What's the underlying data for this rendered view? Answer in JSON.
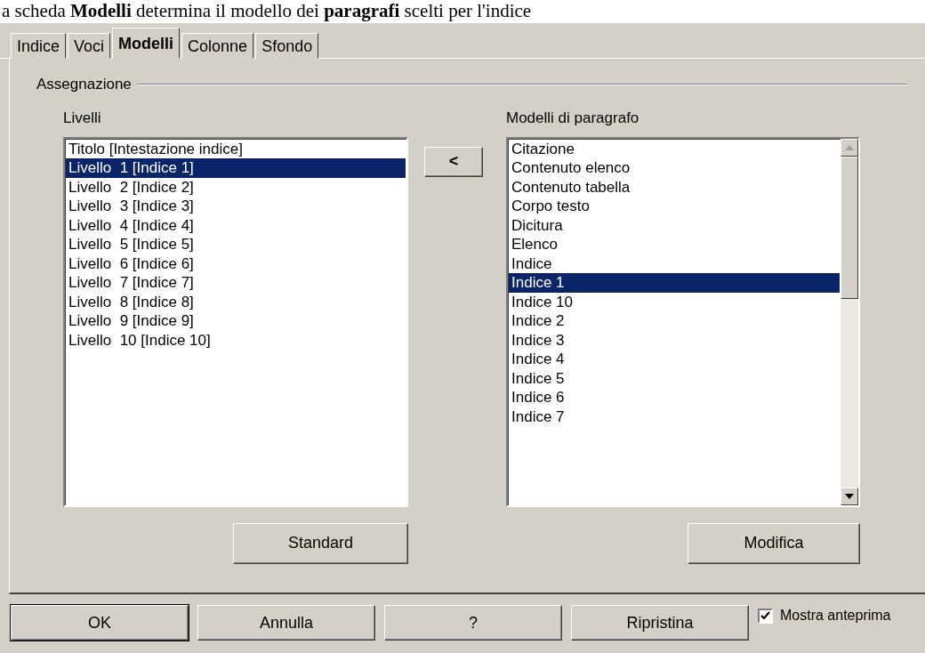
{
  "caption": "a scheda **Modelli** determina il modello dei **paragrafi** scelti per l'indice",
  "tabs": [
    {
      "label": "Indice",
      "selected": false
    },
    {
      "label": "Voci",
      "selected": false
    },
    {
      "label": "Modelli",
      "selected": true
    },
    {
      "label": "Colonne",
      "selected": false
    },
    {
      "label": "Sfondo",
      "selected": false
    }
  ],
  "group_title": "Assegnazione",
  "levels": {
    "label": "Livelli",
    "items": [
      {
        "text": "Titolo [Intestazione indice]",
        "selected": false
      },
      {
        "text": "Livello  1 [Indice 1]",
        "selected": true
      },
      {
        "text": "Livello  2 [Indice 2]",
        "selected": false
      },
      {
        "text": "Livello  3 [Indice 3]",
        "selected": false
      },
      {
        "text": "Livello  4 [Indice 4]",
        "selected": false
      },
      {
        "text": "Livello  5 [Indice 5]",
        "selected": false
      },
      {
        "text": "Livello  6 [Indice 6]",
        "selected": false
      },
      {
        "text": "Livello  7 [Indice 7]",
        "selected": false
      },
      {
        "text": "Livello  8 [Indice 8]",
        "selected": false
      },
      {
        "text": "Livello  9 [Indice 9]",
        "selected": false
      },
      {
        "text": "Livello  10 [Indice 10]",
        "selected": false
      }
    ],
    "button": "Standard"
  },
  "assign_button": "<",
  "styles": {
    "label": "Modelli di paragrafo",
    "items": [
      {
        "text": "Citazione",
        "selected": false
      },
      {
        "text": "Contenuto elenco",
        "selected": false
      },
      {
        "text": "Contenuto tabella",
        "selected": false
      },
      {
        "text": "Corpo testo",
        "selected": false
      },
      {
        "text": "Dicitura",
        "selected": false
      },
      {
        "text": "Elenco",
        "selected": false
      },
      {
        "text": "Indice",
        "selected": false
      },
      {
        "text": "Indice 1",
        "selected": true
      },
      {
        "text": "Indice 10",
        "selected": false
      },
      {
        "text": "Indice 2",
        "selected": false
      },
      {
        "text": "Indice 3",
        "selected": false
      },
      {
        "text": "Indice 4",
        "selected": false
      },
      {
        "text": "Indice 5",
        "selected": false
      },
      {
        "text": "Indice 6",
        "selected": false
      },
      {
        "text": "Indice 7",
        "selected": false
      }
    ],
    "button": "Modifica"
  },
  "footer_buttons": [
    "OK",
    "Annulla",
    "?",
    "Ripristina"
  ],
  "preview": {
    "label": "Mostra anteprima",
    "checked": true
  }
}
